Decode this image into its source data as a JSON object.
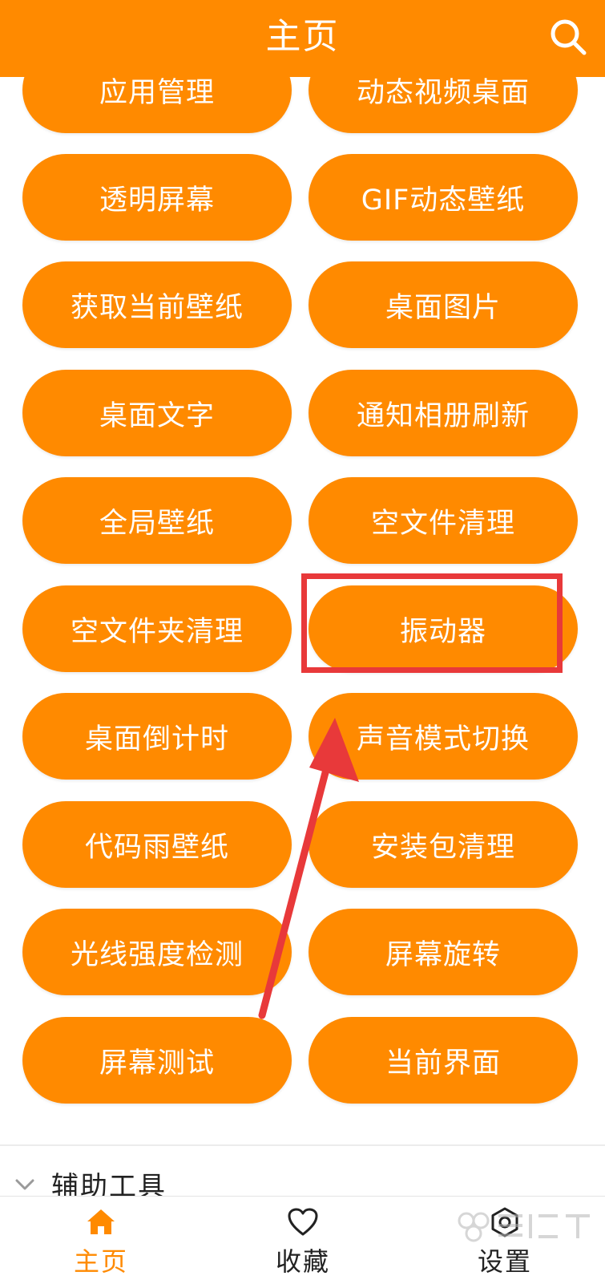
{
  "header": {
    "title": "主页",
    "search_icon": "search-icon"
  },
  "colors": {
    "accent": "#FF8A00",
    "text_on_accent": "#FFFFFF",
    "annotation_red": "#E8393A"
  },
  "grid": {
    "items": [
      {
        "label": "应用管理"
      },
      {
        "label": "动态视频桌面"
      },
      {
        "label": "透明屏幕"
      },
      {
        "label": "GIF动态壁纸"
      },
      {
        "label": "获取当前壁纸"
      },
      {
        "label": "桌面图片"
      },
      {
        "label": "桌面文字"
      },
      {
        "label": "通知相册刷新"
      },
      {
        "label": "全局壁纸"
      },
      {
        "label": "空文件清理"
      },
      {
        "label": "空文件夹清理"
      },
      {
        "label": "振动器"
      },
      {
        "label": "桌面倒计时"
      },
      {
        "label": "声音模式切换"
      },
      {
        "label": "代码雨壁纸"
      },
      {
        "label": "安装包清理"
      },
      {
        "label": "光线强度检测"
      },
      {
        "label": "屏幕旋转"
      },
      {
        "label": "屏幕测试"
      },
      {
        "label": "当前界面"
      }
    ]
  },
  "section": {
    "title": "辅助工具",
    "icon": "chevron-down-icon"
  },
  "bottom_nav": {
    "items": [
      {
        "label": "主页",
        "icon": "home-icon",
        "active": true
      },
      {
        "label": "收藏",
        "icon": "heart-icon",
        "active": false
      },
      {
        "label": "设置",
        "icon": "settings-icon",
        "active": false
      }
    ],
    "active_color": "#FF8A00",
    "inactive_color": "#222222"
  },
  "annotation": {
    "highlighted_item": "振动器"
  }
}
